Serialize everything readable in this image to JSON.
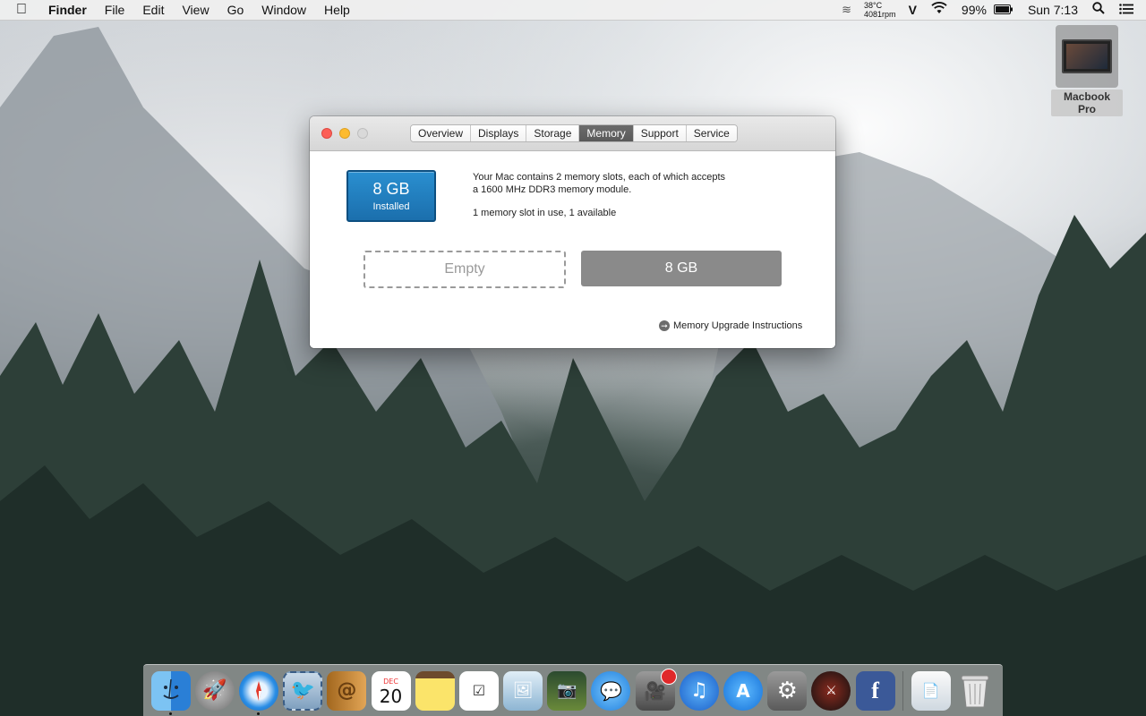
{
  "menubar": {
    "apple_icon": "",
    "app_name": "Finder",
    "menus": [
      "File",
      "Edit",
      "View",
      "Go",
      "Window",
      "Help"
    ],
    "temperature": "38°C",
    "fan": "4081rpm",
    "v_icon": "V",
    "battery": "99%",
    "clock": "Sun 7:13"
  },
  "desktop": {
    "icon_label": "Macbook Pro"
  },
  "window": {
    "tabs": [
      "Overview",
      "Displays",
      "Storage",
      "Memory",
      "Support",
      "Service"
    ],
    "active_tab": "Memory",
    "installed": {
      "size": "8 GB",
      "label": "Installed"
    },
    "description": {
      "line1": "Your Mac contains 2 memory slots, each of which accepts",
      "line2": "a 1600 MHz DDR3 memory module.",
      "status": "1 memory slot in use, 1 available"
    },
    "slot_empty": "Empty",
    "slot_full": "8 GB",
    "upgrade_link": "Memory Upgrade Instructions"
  },
  "dock": {
    "apps": [
      "finder",
      "launchpad",
      "safari",
      "mail",
      "contacts",
      "calendar",
      "notes",
      "reminders",
      "preview",
      "photo-booth",
      "messages",
      "facetime",
      "itunes",
      "app-store",
      "system-preferences",
      "dota-2",
      "facebook"
    ],
    "calendar_month": "DEC",
    "calendar_day": "20"
  },
  "colors": {
    "accent": "#1b6fad",
    "active_tab": "#5a5a5a"
  }
}
